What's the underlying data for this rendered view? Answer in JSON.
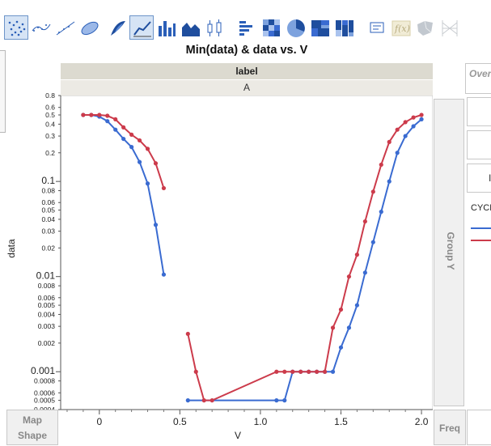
{
  "toolbar": {
    "buttons": [
      {
        "name": "points-graph-button",
        "icon": "points-icon",
        "selected": true
      },
      {
        "name": "smoother-graph-button",
        "icon": "smoother-icon",
        "selected": false
      },
      {
        "name": "line-of-fit-graph-button",
        "icon": "line-of-fit-icon",
        "selected": false
      },
      {
        "name": "ellipse-graph-button",
        "icon": "ellipse-icon",
        "selected": false
      },
      {
        "name": "contour-graph-button",
        "icon": "contour-icon",
        "selected": false
      },
      {
        "name": "line-graph-button",
        "icon": "line-chart-icon",
        "selected": true
      },
      {
        "name": "bar-graph-button",
        "icon": "bar-chart-icon",
        "selected": false
      },
      {
        "name": "area-graph-button",
        "icon": "area-chart-icon",
        "selected": false
      },
      {
        "name": "box-plot-graph-button",
        "icon": "box-plot-icon",
        "selected": false
      },
      {
        "name": "histogram-graph-button",
        "icon": "histogram-icon",
        "selected": false
      },
      {
        "name": "heatmap-graph-button",
        "icon": "heatmap-icon",
        "selected": false
      },
      {
        "name": "pie-graph-button",
        "icon": "pie-chart-icon",
        "selected": false
      },
      {
        "name": "treemap-graph-button",
        "icon": "treemap-icon",
        "selected": false
      },
      {
        "name": "mosaic-graph-button",
        "icon": "mosaic-icon",
        "selected": false
      },
      {
        "name": "caption-box-button",
        "icon": "caption-box-icon",
        "selected": false
      },
      {
        "name": "formula-button",
        "icon": "formula-icon",
        "selected": false
      },
      {
        "name": "map-shapes-button",
        "icon": "map-shapes-icon",
        "selected": false
      },
      {
        "name": "parallel-button",
        "icon": "parallel-icon",
        "selected": false
      }
    ]
  },
  "graph": {
    "title": "Min(data) & data vs. V",
    "wrap_header": "label",
    "wrap_value": "A",
    "y_axis_title": "data",
    "x_axis_title": "V",
    "group_y": "Group Y",
    "overlay_label": "Over",
    "legend_title": "CYCL",
    "map_shape": "Map\nShape",
    "freq": "Freq"
  },
  "chart_data": {
    "type": "line",
    "xlim": [
      -0.24,
      2.07
    ],
    "ylim": [
      0.0004,
      0.8
    ],
    "y_scale": "log",
    "x_ticks": [
      0,
      0.5,
      1.0,
      1.5,
      2.0
    ],
    "x_tick_labels": [
      "0",
      "0.5",
      "1.0",
      "1.5",
      "2.0"
    ],
    "y_ticks": [
      0.0004,
      0.0005,
      0.0006,
      0.0008,
      0.001,
      0.002,
      0.003,
      0.004,
      0.005,
      0.006,
      0.008,
      0.01,
      0.02,
      0.03,
      0.04,
      0.05,
      0.06,
      0.08,
      0.1,
      0.2,
      0.3,
      0.4,
      0.5,
      0.6,
      0.8
    ],
    "y_tick_labels": [
      "0.0004",
      "0.0005",
      "0.0006",
      "0.0008",
      "0.001",
      "0.002",
      "0.003",
      "0.004",
      "0.005",
      "0.006",
      "0.008",
      "0.01",
      "0.02",
      "0.03",
      "0.04",
      "0.05",
      "0.06",
      "0.08",
      "0.1",
      "0.2",
      "0.3",
      "0.4",
      "0.5",
      "0.6",
      "0.8"
    ],
    "grid": false,
    "legend_position": "right",
    "series": [
      {
        "color": "#3a6bd1",
        "segments": [
          [
            [
              -0.1,
              0.5
            ],
            [
              -0.05,
              0.5
            ],
            [
              0.0,
              0.48
            ],
            [
              0.05,
              0.43
            ],
            [
              0.1,
              0.35
            ],
            [
              0.15,
              0.28
            ],
            [
              0.2,
              0.23
            ],
            [
              0.25,
              0.16
            ],
            [
              0.3,
              0.095
            ],
            [
              0.35,
              0.035
            ],
            [
              0.4,
              0.0105
            ]
          ],
          [
            [
              0.55,
              0.0005
            ],
            [
              1.1,
              0.0005
            ],
            [
              1.15,
              0.0005
            ],
            [
              1.2,
              0.001
            ],
            [
              1.25,
              0.001
            ],
            [
              1.3,
              0.001
            ],
            [
              1.35,
              0.001
            ],
            [
              1.4,
              0.001
            ],
            [
              1.45,
              0.001
            ],
            [
              1.5,
              0.0018
            ],
            [
              1.55,
              0.0029
            ],
            [
              1.6,
              0.005
            ],
            [
              1.65,
              0.011
            ],
            [
              1.7,
              0.023
            ],
            [
              1.75,
              0.048
            ],
            [
              1.8,
              0.1
            ],
            [
              1.85,
              0.2
            ],
            [
              1.9,
              0.3
            ],
            [
              1.95,
              0.38
            ],
            [
              2.0,
              0.45
            ]
          ]
        ]
      },
      {
        "color": "#cc3b4b",
        "segments": [
          [
            [
              -0.1,
              0.5
            ],
            [
              -0.05,
              0.5
            ],
            [
              0.0,
              0.5
            ],
            [
              0.05,
              0.49
            ],
            [
              0.1,
              0.45
            ],
            [
              0.15,
              0.37
            ],
            [
              0.2,
              0.31
            ],
            [
              0.25,
              0.27
            ],
            [
              0.3,
              0.22
            ],
            [
              0.35,
              0.155
            ],
            [
              0.4,
              0.085
            ]
          ],
          [
            [
              0.55,
              0.0025
            ],
            [
              0.6,
              0.001
            ],
            [
              0.65,
              0.0005
            ],
            [
              0.7,
              0.0005
            ],
            [
              1.1,
              0.001
            ],
            [
              1.15,
              0.001
            ],
            [
              1.2,
              0.001
            ],
            [
              1.25,
              0.001
            ],
            [
              1.3,
              0.001
            ],
            [
              1.35,
              0.001
            ],
            [
              1.4,
              0.001
            ],
            [
              1.45,
              0.0029
            ],
            [
              1.5,
              0.0045
            ],
            [
              1.55,
              0.01
            ],
            [
              1.6,
              0.017
            ],
            [
              1.65,
              0.038
            ],
            [
              1.7,
              0.078
            ],
            [
              1.75,
              0.15
            ],
            [
              1.8,
              0.26
            ],
            [
              1.85,
              0.35
            ],
            [
              1.9,
              0.42
            ],
            [
              1.95,
              0.47
            ],
            [
              2.0,
              0.5
            ]
          ]
        ]
      }
    ]
  }
}
